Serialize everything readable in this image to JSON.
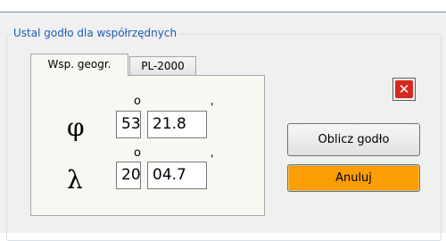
{
  "group": {
    "title": "Ustal godło dla współrzędnych"
  },
  "tabs": [
    {
      "label": "Wsp. geogr.",
      "active": true
    },
    {
      "label": "PL-2000",
      "active": false
    }
  ],
  "coords": {
    "phi": {
      "symbol": "φ",
      "degrees": "53",
      "minutes": "21.8"
    },
    "lambda": {
      "symbol": "λ",
      "degrees": "20",
      "minutes": "04.7"
    },
    "degree_mark": "o",
    "minute_mark": "'"
  },
  "buttons": {
    "close": {
      "glyph": "✕",
      "color": "#d42a1e"
    },
    "compute_label": "Oblicz godło",
    "cancel_label": "Anuluj",
    "cancel_color": "#fc9d06"
  }
}
